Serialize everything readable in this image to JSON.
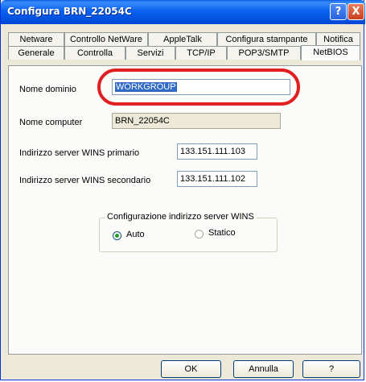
{
  "window": {
    "title": "Configura BRN_22054C",
    "help_label": "?",
    "close_label": "X"
  },
  "tabs": {
    "row1": [
      "Netware",
      "Controllo NetWare",
      "AppleTalk",
      "Configura stampante",
      "Notifica"
    ],
    "row2": [
      "Generale",
      "Controlla",
      "Servizi",
      "TCP/IP",
      "POP3/SMTP",
      "NetBIOS"
    ],
    "active": "NetBIOS"
  },
  "form": {
    "domain_label": "Nome dominio",
    "domain_value": "WORKGROUP",
    "computer_label": "Nome computer",
    "computer_value": "BRN_22054C",
    "wins_primary_label": "Indirizzo server WINS primario",
    "wins_primary_value": "133.151.111.103",
    "wins_secondary_label": "Indirizzo server WINS secondario",
    "wins_secondary_value": "133.151.111.102"
  },
  "wins_config": {
    "title": "Configurazione indirizzo server WINS",
    "auto_label": "Auto",
    "static_label": "Statico",
    "selected": "Auto"
  },
  "buttons": {
    "ok": "OK",
    "cancel": "Annulla",
    "help": "?"
  },
  "colors": {
    "annotation": "#e02020",
    "titlebar": "#0a62f0",
    "selection": "#316ac5"
  }
}
